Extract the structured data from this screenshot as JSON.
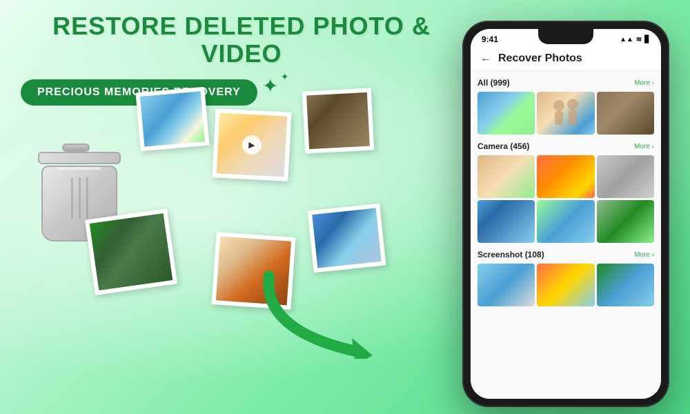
{
  "title": "RESTORE DELETED PHOTO & VIDEO",
  "subtitle_badge": "PRECIOUS MEMORIES RECOVERY",
  "phone": {
    "time": "9:41",
    "header_title": "Recover Photos",
    "back_label": "←",
    "sections": [
      {
        "label": "All (999)",
        "more": "More ›"
      },
      {
        "label": "Camera (456)",
        "more": "More ›"
      },
      {
        "label": "Screenshot (108)",
        "more": "More ›"
      }
    ]
  },
  "icons": {
    "sparkle": "✦",
    "sparkle_small": "✦",
    "back_arrow": "←",
    "signal": "▲▲▲",
    "wifi": "WiFi",
    "battery": "▊"
  }
}
